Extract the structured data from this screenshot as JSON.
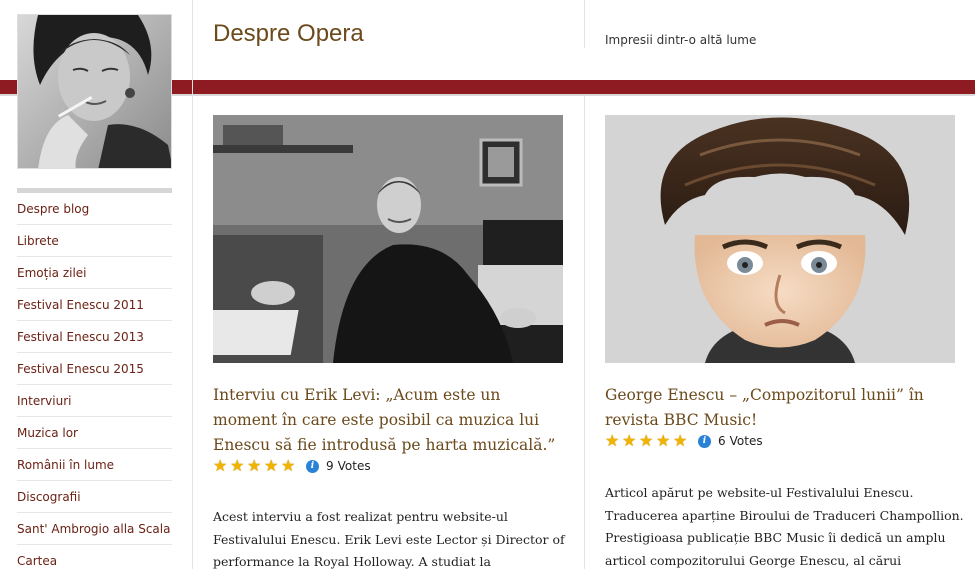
{
  "header": {
    "site_title": "Despre Opera",
    "tagline": "Impresii dintr-o altă lume"
  },
  "sidebar": {
    "items": [
      {
        "label": "Despre blog"
      },
      {
        "label": "Librete"
      },
      {
        "label": "Emoția zilei"
      },
      {
        "label": "Festival Enescu 2011"
      },
      {
        "label": "Festival Enescu 2013"
      },
      {
        "label": "Festival Enescu 2015"
      },
      {
        "label": "Interviuri"
      },
      {
        "label": "Muzica lor"
      },
      {
        "label": "Românii în lume"
      },
      {
        "label": "Discografii"
      },
      {
        "label": "Sant' Ambrogio alla Scala"
      },
      {
        "label": "Cartea"
      }
    ]
  },
  "posts": [
    {
      "title": "Interviu cu Erik Levi: „Acum este un moment în care este posibil ca muzica lui Enescu să fie introdusă pe harta muzicală.”",
      "rating": 5,
      "votes_count": "9",
      "votes_label": "Votes",
      "excerpt": "Acest interviu a fost realizat pentru website-ul Festivalului Enescu. Erik Levi este Lector și Director of performance la Royal Holloway. A studiat la"
    },
    {
      "title": "George Enescu – „Compozitorul lunii” în revista BBC Music!",
      "rating": 5,
      "votes_count": "6",
      "votes_label": "Votes",
      "excerpt": "Articol apărut pe website-ul Festivalului Enescu. Traducerea aparține Biroului de Traduceri Champollion. Prestigioasa publicație BBC Music îi dedică un amplu articol compozitorului George Enescu, al cărui"
    }
  ],
  "colors": {
    "accent_band": "#8e1a22",
    "title_brown": "#6b4a1c",
    "nav_link": "#6b2216",
    "star_gold": "#f0b400",
    "info_blue": "#2a82d6"
  },
  "icons": {
    "star": "star-icon",
    "info": "info-icon"
  }
}
